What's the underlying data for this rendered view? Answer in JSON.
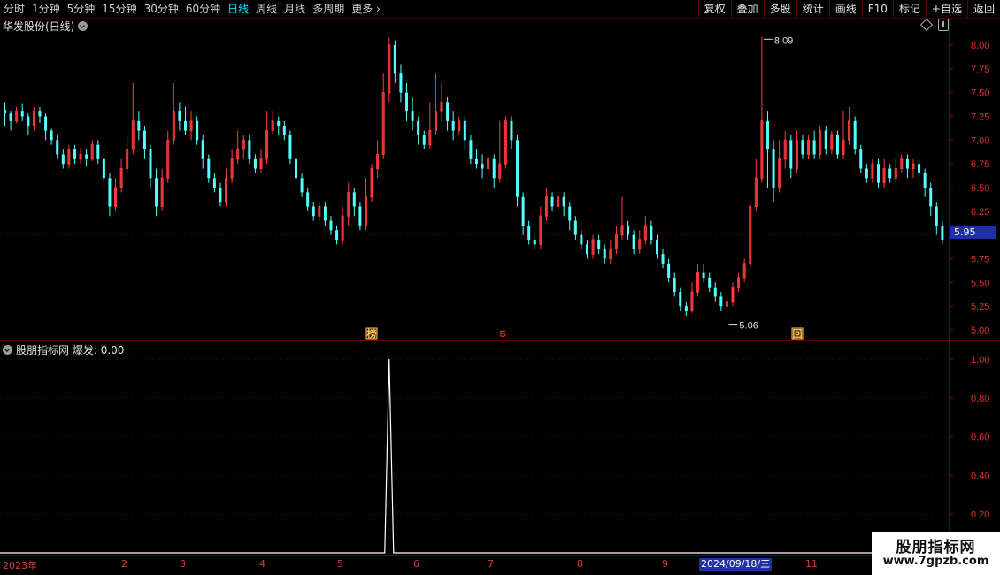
{
  "toolbar": {
    "periods": [
      "分时",
      "1分钟",
      "5分钟",
      "15分钟",
      "30分钟",
      "60分钟",
      "日线",
      "周线",
      "月线",
      "多周期"
    ],
    "active_period": "日线",
    "more_label": "更多",
    "buttons": [
      "复权",
      "叠加",
      "多股",
      "统计",
      "画线",
      "F10",
      "标记",
      "+自选",
      "返回"
    ]
  },
  "chart": {
    "title": "华发股份(日线)",
    "current_price": "5.95",
    "high_label": "8.09",
    "low_label": "5.06",
    "price_ticks": [
      "8.00",
      "7.75",
      "7.50",
      "7.25",
      "7.00",
      "6.75",
      "6.50",
      "6.25",
      "6.00",
      "5.75",
      "5.50",
      "5.25",
      "5.00"
    ],
    "markers": [
      "榜",
      "S",
      "回"
    ]
  },
  "indicator": {
    "name": "股朋指标网",
    "label": "爆发:",
    "value": "0.00",
    "ticks": [
      "1.00",
      "0.80",
      "0.60",
      "0.40",
      "0.20"
    ]
  },
  "x_axis": {
    "labels": [
      "2023年",
      "2",
      "3",
      "4",
      "5",
      "6",
      "7",
      "8",
      "9",
      "11"
    ],
    "cursor_date": "2024/09/18/三"
  },
  "watermark": {
    "line1": "股朋指标网",
    "line2": "www.7gpzb.com"
  },
  "colors": {
    "up": "#ff3c3c",
    "down": "#54ffff",
    "axis": "#b00000",
    "grid": "#5a0000",
    "active": "#00e5ff"
  },
  "chart_data": {
    "type": "candlestick",
    "ylim": [
      5.0,
      8.1
    ],
    "series": [
      {
        "values": [
          [
            7.32,
            7.28,
            7.4,
            7.15
          ],
          [
            7.28,
            7.2,
            7.3,
            7.1
          ],
          [
            7.2,
            7.3,
            7.35,
            7.18
          ],
          [
            7.3,
            7.25,
            7.38,
            7.2
          ],
          [
            7.25,
            7.15,
            7.28,
            7.05
          ],
          [
            7.15,
            7.3,
            7.35,
            7.1
          ],
          [
            7.3,
            7.25,
            7.35,
            7.18
          ],
          [
            7.25,
            7.1,
            7.28,
            7.0
          ],
          [
            7.1,
            7.0,
            7.12,
            6.95
          ],
          [
            7.0,
            6.85,
            7.05,
            6.8
          ],
          [
            6.85,
            6.75,
            6.9,
            6.7
          ],
          [
            6.75,
            6.9,
            6.95,
            6.7
          ],
          [
            6.9,
            6.8,
            6.95,
            6.75
          ],
          [
            6.8,
            6.85,
            6.92,
            6.75
          ],
          [
            6.85,
            6.8,
            6.9,
            6.72
          ],
          [
            6.8,
            6.95,
            7.0,
            6.78
          ],
          [
            6.95,
            6.8,
            7.0,
            6.75
          ],
          [
            6.8,
            6.6,
            6.85,
            6.55
          ],
          [
            6.6,
            6.3,
            6.65,
            6.2
          ],
          [
            6.3,
            6.5,
            6.6,
            6.25
          ],
          [
            6.5,
            6.7,
            6.8,
            6.45
          ],
          [
            6.7,
            6.9,
            7.05,
            6.65
          ],
          [
            6.9,
            7.2,
            7.6,
            6.85
          ],
          [
            7.2,
            7.1,
            7.3,
            7.0
          ],
          [
            7.1,
            6.9,
            7.15,
            6.8
          ],
          [
            6.9,
            6.6,
            6.95,
            6.5
          ],
          [
            6.6,
            6.3,
            6.7,
            6.2
          ],
          [
            6.3,
            6.6,
            6.7,
            6.25
          ],
          [
            6.6,
            7.0,
            7.1,
            6.55
          ],
          [
            7.0,
            7.3,
            7.6,
            6.95
          ],
          [
            7.3,
            7.2,
            7.4,
            7.1
          ],
          [
            7.2,
            7.1,
            7.35,
            7.05
          ],
          [
            7.1,
            7.2,
            7.3,
            7.0
          ],
          [
            7.2,
            7.0,
            7.25,
            6.95
          ],
          [
            7.0,
            6.8,
            7.05,
            6.7
          ],
          [
            6.8,
            6.6,
            6.85,
            6.55
          ],
          [
            6.6,
            6.5,
            6.65,
            6.45
          ],
          [
            6.5,
            6.35,
            6.55,
            6.3
          ],
          [
            6.35,
            6.6,
            6.7,
            6.3
          ],
          [
            6.6,
            6.8,
            6.9,
            6.55
          ],
          [
            6.8,
            6.9,
            7.1,
            6.75
          ],
          [
            6.9,
            7.0,
            7.05,
            6.8
          ],
          [
            7.0,
            6.8,
            7.05,
            6.75
          ],
          [
            6.8,
            6.7,
            6.85,
            6.65
          ],
          [
            6.7,
            6.8,
            6.9,
            6.65
          ],
          [
            6.8,
            7.1,
            7.3,
            6.75
          ],
          [
            7.1,
            7.2,
            7.3,
            7.05
          ],
          [
            7.2,
            7.15,
            7.25,
            7.05
          ],
          [
            7.15,
            7.05,
            7.2,
            7.0
          ],
          [
            7.05,
            6.8,
            7.1,
            6.75
          ],
          [
            6.8,
            6.6,
            6.85,
            6.5
          ],
          [
            6.6,
            6.45,
            6.65,
            6.4
          ],
          [
            6.45,
            6.3,
            6.5,
            6.25
          ],
          [
            6.3,
            6.2,
            6.35,
            6.15
          ],
          [
            6.2,
            6.3,
            6.35,
            6.15
          ],
          [
            6.3,
            6.15,
            6.35,
            6.1
          ],
          [
            6.15,
            6.05,
            6.2,
            6.0
          ],
          [
            6.05,
            5.95,
            6.1,
            5.9
          ],
          [
            5.95,
            6.2,
            6.3,
            5.9
          ],
          [
            6.2,
            6.45,
            6.55,
            6.1
          ],
          [
            6.45,
            6.3,
            6.5,
            6.2
          ],
          [
            6.3,
            6.1,
            6.35,
            6.05
          ],
          [
            6.1,
            6.4,
            6.6,
            6.05
          ],
          [
            6.4,
            6.7,
            6.75,
            6.35
          ],
          [
            6.7,
            6.85,
            7.0,
            6.6
          ],
          [
            6.85,
            7.5,
            7.7,
            6.8
          ],
          [
            7.5,
            8.0,
            8.08,
            7.4
          ],
          [
            8.0,
            7.7,
            8.05,
            7.6
          ],
          [
            7.7,
            7.5,
            7.8,
            7.4
          ],
          [
            7.5,
            7.3,
            7.6,
            7.2
          ],
          [
            7.3,
            7.2,
            7.45,
            7.1
          ],
          [
            7.2,
            7.05,
            7.25,
            6.95
          ],
          [
            7.05,
            6.95,
            7.1,
            6.9
          ],
          [
            6.95,
            7.1,
            7.4,
            6.9
          ],
          [
            7.1,
            7.3,
            7.7,
            7.05
          ],
          [
            7.3,
            7.4,
            7.6,
            7.2
          ],
          [
            7.4,
            7.2,
            7.45,
            7.1
          ],
          [
            7.2,
            7.1,
            7.3,
            7.0
          ],
          [
            7.1,
            7.2,
            7.25,
            7.05
          ],
          [
            7.2,
            7.0,
            7.25,
            6.9
          ],
          [
            7.0,
            6.8,
            7.05,
            6.75
          ],
          [
            6.8,
            6.75,
            6.9,
            6.7
          ],
          [
            6.75,
            6.7,
            6.85,
            6.6
          ],
          [
            6.7,
            6.8,
            6.85,
            6.65
          ],
          [
            6.8,
            6.6,
            6.85,
            6.5
          ],
          [
            6.6,
            6.75,
            7.2,
            6.55
          ],
          [
            6.75,
            7.2,
            7.25,
            6.7
          ],
          [
            7.2,
            7.0,
            7.25,
            6.9
          ],
          [
            7.0,
            6.4,
            7.05,
            6.3
          ],
          [
            6.4,
            6.1,
            6.45,
            6.0
          ],
          [
            6.1,
            5.95,
            6.15,
            5.9
          ],
          [
            5.95,
            5.9,
            6.0,
            5.85
          ],
          [
            5.9,
            6.2,
            6.3,
            5.85
          ],
          [
            6.2,
            6.4,
            6.5,
            6.15
          ],
          [
            6.4,
            6.3,
            6.45,
            6.25
          ],
          [
            6.3,
            6.4,
            6.45,
            6.25
          ],
          [
            6.4,
            6.3,
            6.45,
            6.2
          ],
          [
            6.3,
            6.15,
            6.35,
            6.05
          ],
          [
            6.15,
            6.0,
            6.2,
            5.95
          ],
          [
            6.0,
            5.9,
            6.05,
            5.85
          ],
          [
            5.9,
            5.8,
            5.95,
            5.75
          ],
          [
            5.8,
            5.95,
            6.0,
            5.75
          ],
          [
            5.95,
            5.85,
            6.0,
            5.8
          ],
          [
            5.85,
            5.75,
            5.9,
            5.7
          ],
          [
            5.75,
            5.85,
            5.95,
            5.7
          ],
          [
            5.85,
            6.0,
            6.1,
            5.8
          ],
          [
            6.0,
            6.1,
            6.4,
            5.95
          ],
          [
            6.1,
            6.0,
            6.15,
            5.95
          ],
          [
            6.0,
            5.85,
            6.05,
            5.8
          ],
          [
            5.85,
            5.95,
            6.05,
            5.8
          ],
          [
            5.95,
            6.1,
            6.2,
            5.9
          ],
          [
            6.1,
            5.95,
            6.15,
            5.9
          ],
          [
            5.95,
            5.8,
            6.0,
            5.75
          ],
          [
            5.8,
            5.7,
            5.85,
            5.65
          ],
          [
            5.7,
            5.55,
            5.75,
            5.5
          ],
          [
            5.55,
            5.4,
            5.6,
            5.35
          ],
          [
            5.4,
            5.25,
            5.45,
            5.2
          ],
          [
            5.25,
            5.2,
            5.3,
            5.15
          ],
          [
            5.2,
            5.4,
            5.5,
            5.18
          ],
          [
            5.4,
            5.6,
            5.7,
            5.35
          ],
          [
            5.6,
            5.55,
            5.7,
            5.5
          ],
          [
            5.55,
            5.45,
            5.6,
            5.4
          ],
          [
            5.45,
            5.35,
            5.5,
            5.3
          ],
          [
            5.35,
            5.25,
            5.4,
            5.2
          ],
          [
            5.25,
            5.3,
            5.35,
            5.06
          ],
          [
            5.3,
            5.45,
            5.5,
            5.25
          ],
          [
            5.45,
            5.55,
            5.6,
            5.4
          ],
          [
            5.55,
            5.7,
            5.75,
            5.5
          ],
          [
            5.7,
            6.3,
            6.35,
            5.65
          ],
          [
            6.3,
            6.6,
            6.8,
            6.25
          ],
          [
            6.6,
            7.2,
            8.09,
            6.55
          ],
          [
            7.2,
            6.9,
            7.3,
            6.5
          ],
          [
            6.9,
            6.5,
            7.0,
            6.35
          ],
          [
            6.5,
            6.8,
            7.0,
            6.45
          ],
          [
            6.8,
            7.0,
            7.1,
            6.7
          ],
          [
            7.0,
            6.7,
            7.05,
            6.6
          ],
          [
            6.7,
            7.0,
            7.1,
            6.65
          ],
          [
            7.0,
            6.85,
            7.05,
            6.8
          ],
          [
            6.85,
            7.0,
            7.05,
            6.8
          ],
          [
            7.0,
            6.85,
            7.1,
            6.8
          ],
          [
            6.85,
            7.1,
            7.15,
            6.8
          ],
          [
            7.1,
            6.9,
            7.15,
            6.85
          ],
          [
            6.9,
            7.05,
            7.1,
            6.85
          ],
          [
            7.05,
            6.85,
            7.1,
            6.8
          ],
          [
            6.85,
            7.0,
            7.3,
            6.8
          ],
          [
            7.0,
            7.2,
            7.35,
            6.95
          ],
          [
            7.2,
            6.9,
            7.25,
            6.85
          ],
          [
            6.9,
            6.7,
            6.95,
            6.65
          ],
          [
            6.7,
            6.6,
            6.75,
            6.55
          ],
          [
            6.6,
            6.75,
            6.8,
            6.55
          ],
          [
            6.75,
            6.55,
            6.8,
            6.5
          ],
          [
            6.55,
            6.7,
            6.8,
            6.5
          ],
          [
            6.7,
            6.6,
            6.75,
            6.55
          ],
          [
            6.6,
            6.7,
            6.8,
            6.55
          ],
          [
            6.7,
            6.8,
            6.85,
            6.65
          ],
          [
            6.8,
            6.7,
            6.85,
            6.6
          ],
          [
            6.7,
            6.75,
            6.8,
            6.6
          ],
          [
            6.75,
            6.65,
            6.8,
            6.6
          ],
          [
            6.65,
            6.5,
            6.7,
            6.4
          ],
          [
            6.5,
            6.3,
            6.55,
            6.2
          ],
          [
            6.3,
            6.1,
            6.35,
            6.0
          ],
          [
            6.1,
            5.95,
            6.15,
            5.9
          ]
        ]
      }
    ],
    "indicator_series": {
      "name": "爆发",
      "spike_index": 66,
      "spike_value": 1.0,
      "baseline": 0.0
    }
  }
}
